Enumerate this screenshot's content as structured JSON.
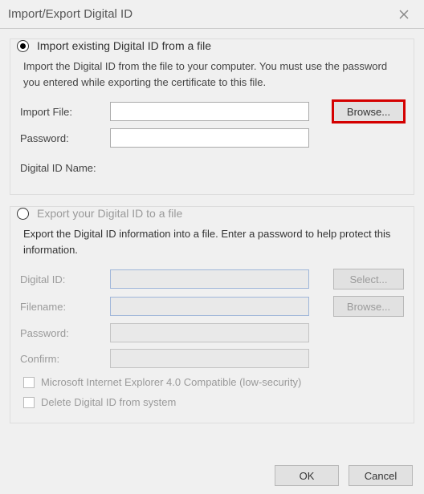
{
  "window": {
    "title": "Import/Export Digital ID",
    "close_icon": "close"
  },
  "import_section": {
    "heading": "Import existing Digital ID from a file",
    "selected": true,
    "description": "Import the Digital ID from the file to your computer. You must use the password you entered while exporting the certificate to this file.",
    "rows": {
      "import_file": {
        "label": "Import File:",
        "value": ""
      },
      "password": {
        "label": "Password:",
        "value": ""
      },
      "id_name": {
        "label": "Digital ID Name:",
        "value": ""
      }
    },
    "browse_label": "Browse..."
  },
  "export_section": {
    "heading": "Export your Digital ID to a file",
    "selected": false,
    "description": "Export the Digital ID information into a file. Enter a password to help protect this information.",
    "rows": {
      "digital_id": {
        "label": "Digital ID:",
        "value": ""
      },
      "filename": {
        "label": "Filename:",
        "value": ""
      },
      "password": {
        "label": "Password:",
        "value": ""
      },
      "confirm": {
        "label": "Confirm:",
        "value": ""
      }
    },
    "select_label": "Select...",
    "browse_label": "Browse...",
    "checkboxes": {
      "ie4_compat": {
        "label": "Microsoft Internet Explorer 4.0 Compatible (low-security)",
        "checked": false
      },
      "delete_from_sys": {
        "label": "Delete Digital ID from system",
        "checked": false
      }
    }
  },
  "footer": {
    "ok_label": "OK",
    "cancel_label": "Cancel"
  }
}
